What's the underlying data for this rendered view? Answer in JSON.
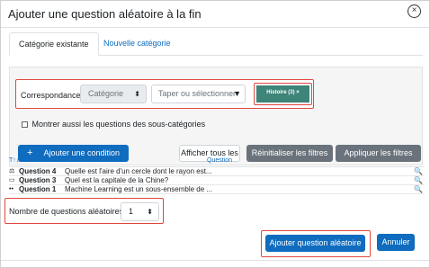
{
  "dialog": {
    "title": "Ajouter une question aléatoire à la fin",
    "close_glyph": "×"
  },
  "tabs": [
    {
      "label": "Catégorie existante",
      "active": true
    },
    {
      "label": "Nouvelle catégorie",
      "active": false
    }
  ],
  "filter": {
    "label": "Correspondance",
    "type_value": "Catégorie",
    "type_arrow": "⬍",
    "search_placeholder": "Taper ou sélectionner",
    "search_arrow": "▼",
    "chip_label": "Histoire (3)",
    "chip_remove": "×",
    "include_subcats_label": "Montrer aussi les questions des sous-catégories"
  },
  "buttons": {
    "add_condition_icon": "+",
    "add_condition": "Ajouter une condition",
    "show_all": "Afficher tous les",
    "reset": "Réinitialiser les filtres",
    "apply": "Appliquer les filtres"
  },
  "table": {
    "sort_header": "T↑↓",
    "question_header": "Question",
    "rows": [
      {
        "icon": "⚖",
        "name": "Question 4",
        "text": "Quelle est l'aire d'un cercle dont le rayon est...",
        "preview_icon": "🔍"
      },
      {
        "icon": "▭",
        "name": "Question 3",
        "text": "Quel est la capitale de la Chine?",
        "preview_icon": "🔍"
      },
      {
        "icon": "••",
        "name": "Question 1",
        "text": "Machine Learning est un sous-ensemble de ...",
        "preview_icon": "🔍"
      }
    ]
  },
  "random_count": {
    "label": "Nombre de questions aléatoires",
    "value": "1",
    "arrow": "⬍"
  },
  "footer": {
    "add_random": "Ajouter question aléatoire",
    "cancel": "Annuler"
  },
  "colors": {
    "primary": "#0f6cbf",
    "secondary": "#6a737b",
    "chip": "#3e8478",
    "highlight": "#e0483e"
  }
}
